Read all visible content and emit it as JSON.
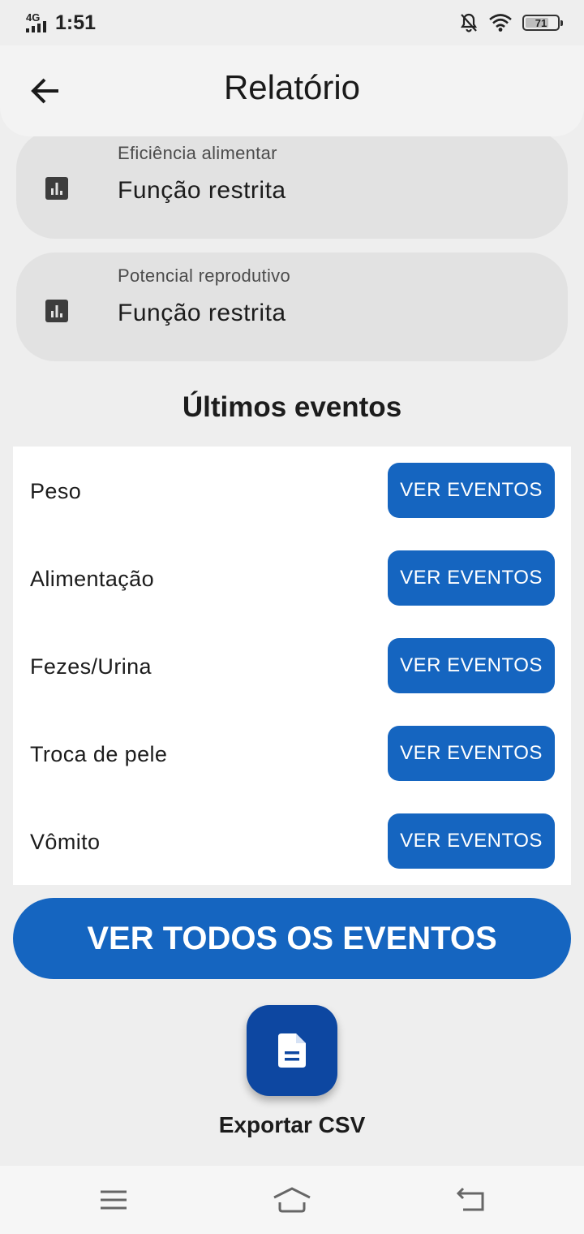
{
  "status_bar": {
    "network": "4G",
    "time": "1:51",
    "battery": "71"
  },
  "app_bar": {
    "title": "Relatório",
    "back_icon": "arrow-back-icon"
  },
  "cards": [
    {
      "label": "Eficiência alimentar",
      "value": "Função restrita",
      "icon": "bar-chart-icon"
    },
    {
      "label": "Potencial reprodutivo",
      "value": "Função restrita",
      "icon": "bar-chart-icon"
    }
  ],
  "events": {
    "title": "Últimos eventos",
    "rows": [
      {
        "label": "Peso",
        "button": "VER EVENTOS"
      },
      {
        "label": "Alimentação",
        "button": "VER EVENTOS"
      },
      {
        "label": "Fezes/Urina",
        "button": "VER EVENTOS"
      },
      {
        "label": "Troca de pele",
        "button": "VER EVENTOS"
      },
      {
        "label": "Vômito",
        "button": "VER EVENTOS"
      }
    ]
  },
  "all_events_button": "VER TODOS OS EVENTOS",
  "export": {
    "label": "Exportar CSV",
    "icon": "document-icon"
  },
  "colors": {
    "primary": "#1565c0",
    "fab": "#0d47a1",
    "background": "#eeeeee",
    "card": "#e2e2e2"
  }
}
